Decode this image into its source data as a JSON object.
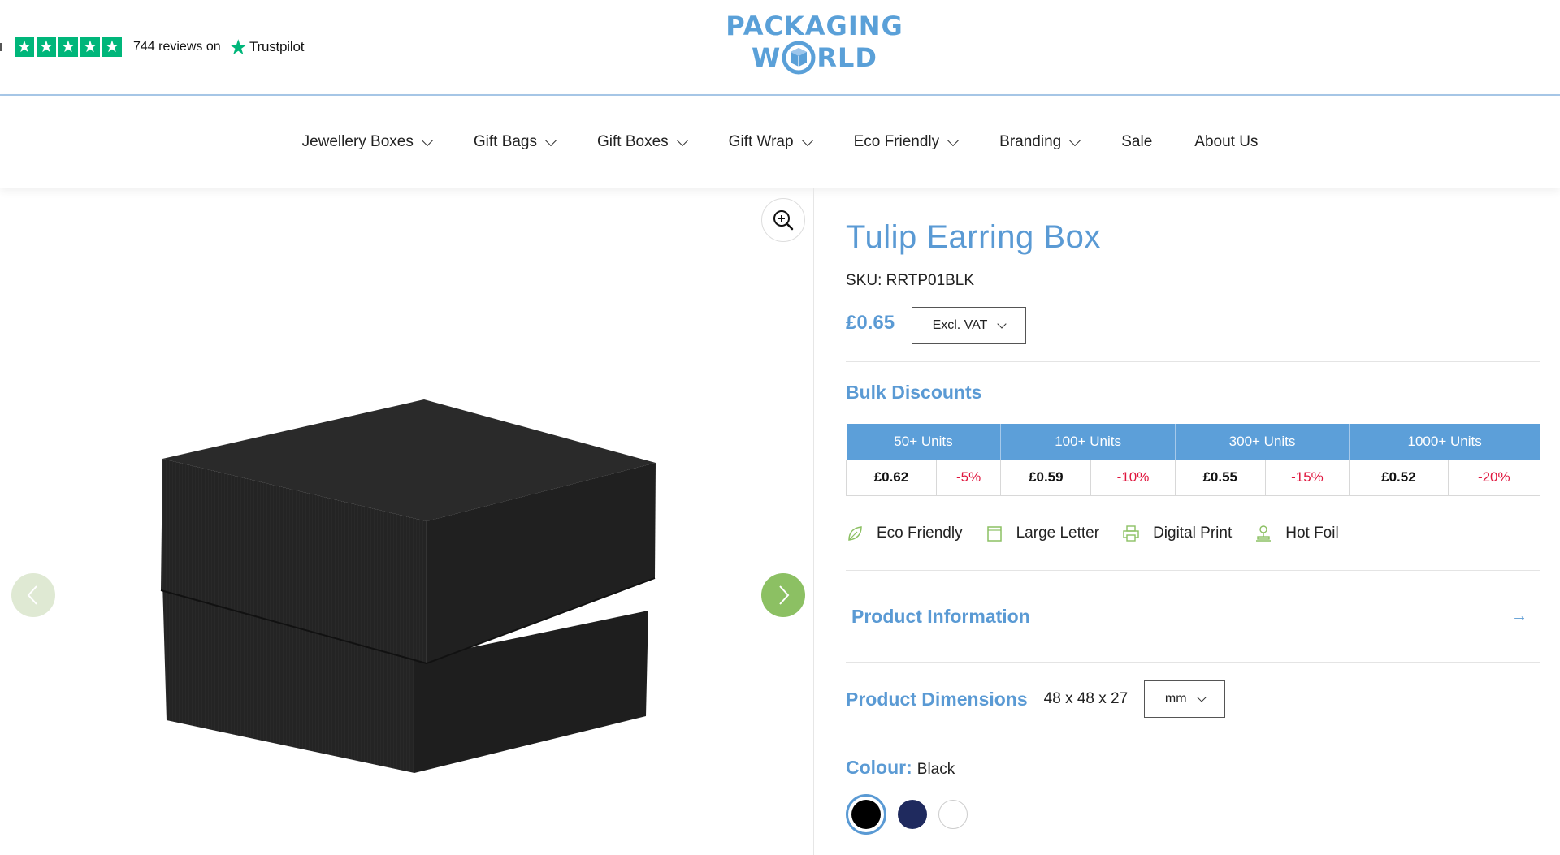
{
  "header": {
    "trustpilot": {
      "reviews_text": "744 reviews on",
      "brand": "Trustpilot",
      "star_color": "#00b67a"
    },
    "logo": {
      "line1": "PACKAGING",
      "line2_left": "W",
      "line2_right": "RLD",
      "color": "#5aa0d8"
    }
  },
  "nav": {
    "items": [
      {
        "label": "Jewellery Boxes",
        "dropdown": true
      },
      {
        "label": "Gift Bags",
        "dropdown": true
      },
      {
        "label": "Gift Boxes",
        "dropdown": true
      },
      {
        "label": "Gift Wrap",
        "dropdown": true
      },
      {
        "label": "Eco Friendly",
        "dropdown": true
      },
      {
        "label": "Branding",
        "dropdown": true
      },
      {
        "label": "Sale",
        "dropdown": false
      },
      {
        "label": "About Us",
        "dropdown": false
      }
    ]
  },
  "gallery": {
    "zoom_icon": "zoom-in-icon",
    "prev_icon": "chevron-left-icon",
    "next_icon": "chevron-right-icon"
  },
  "product": {
    "title": "Tulip Earring Box",
    "sku": "SKU: RRTP01BLK",
    "price": "£0.65",
    "vat_select": "Excl. VAT",
    "bulk_heading": "Bulk Discounts",
    "bulk": [
      {
        "header": "50+ Units",
        "price": "£0.62",
        "discount": "-5%"
      },
      {
        "header": "100+ Units",
        "price": "£0.59",
        "discount": "-10%"
      },
      {
        "header": "300+ Units",
        "price": "£0.55",
        "discount": "-15%"
      },
      {
        "header": "1000+ Units",
        "price": "£0.52",
        "discount": "-20%"
      }
    ],
    "features": [
      {
        "label": "Eco Friendly",
        "icon": "leaf-icon"
      },
      {
        "label": "Large Letter",
        "icon": "letter-icon"
      },
      {
        "label": "Digital Print",
        "icon": "printer-icon"
      },
      {
        "label": "Hot Foil",
        "icon": "stamp-icon"
      }
    ],
    "info_heading": "Product Information",
    "dims_heading": "Product Dimensions",
    "dims_value": "48 x 48 x 27",
    "unit_select": "mm",
    "colour_heading": "Colour:",
    "colour_value": "Black",
    "swatches": [
      {
        "name": "Black",
        "color": "#000000",
        "selected": true
      },
      {
        "name": "Navy",
        "color": "#1f2a5e",
        "selected": false
      },
      {
        "name": "White",
        "color": "#ffffff",
        "selected": false
      }
    ],
    "accent": "#5a9ad4",
    "discount_color": "#e0163e"
  }
}
